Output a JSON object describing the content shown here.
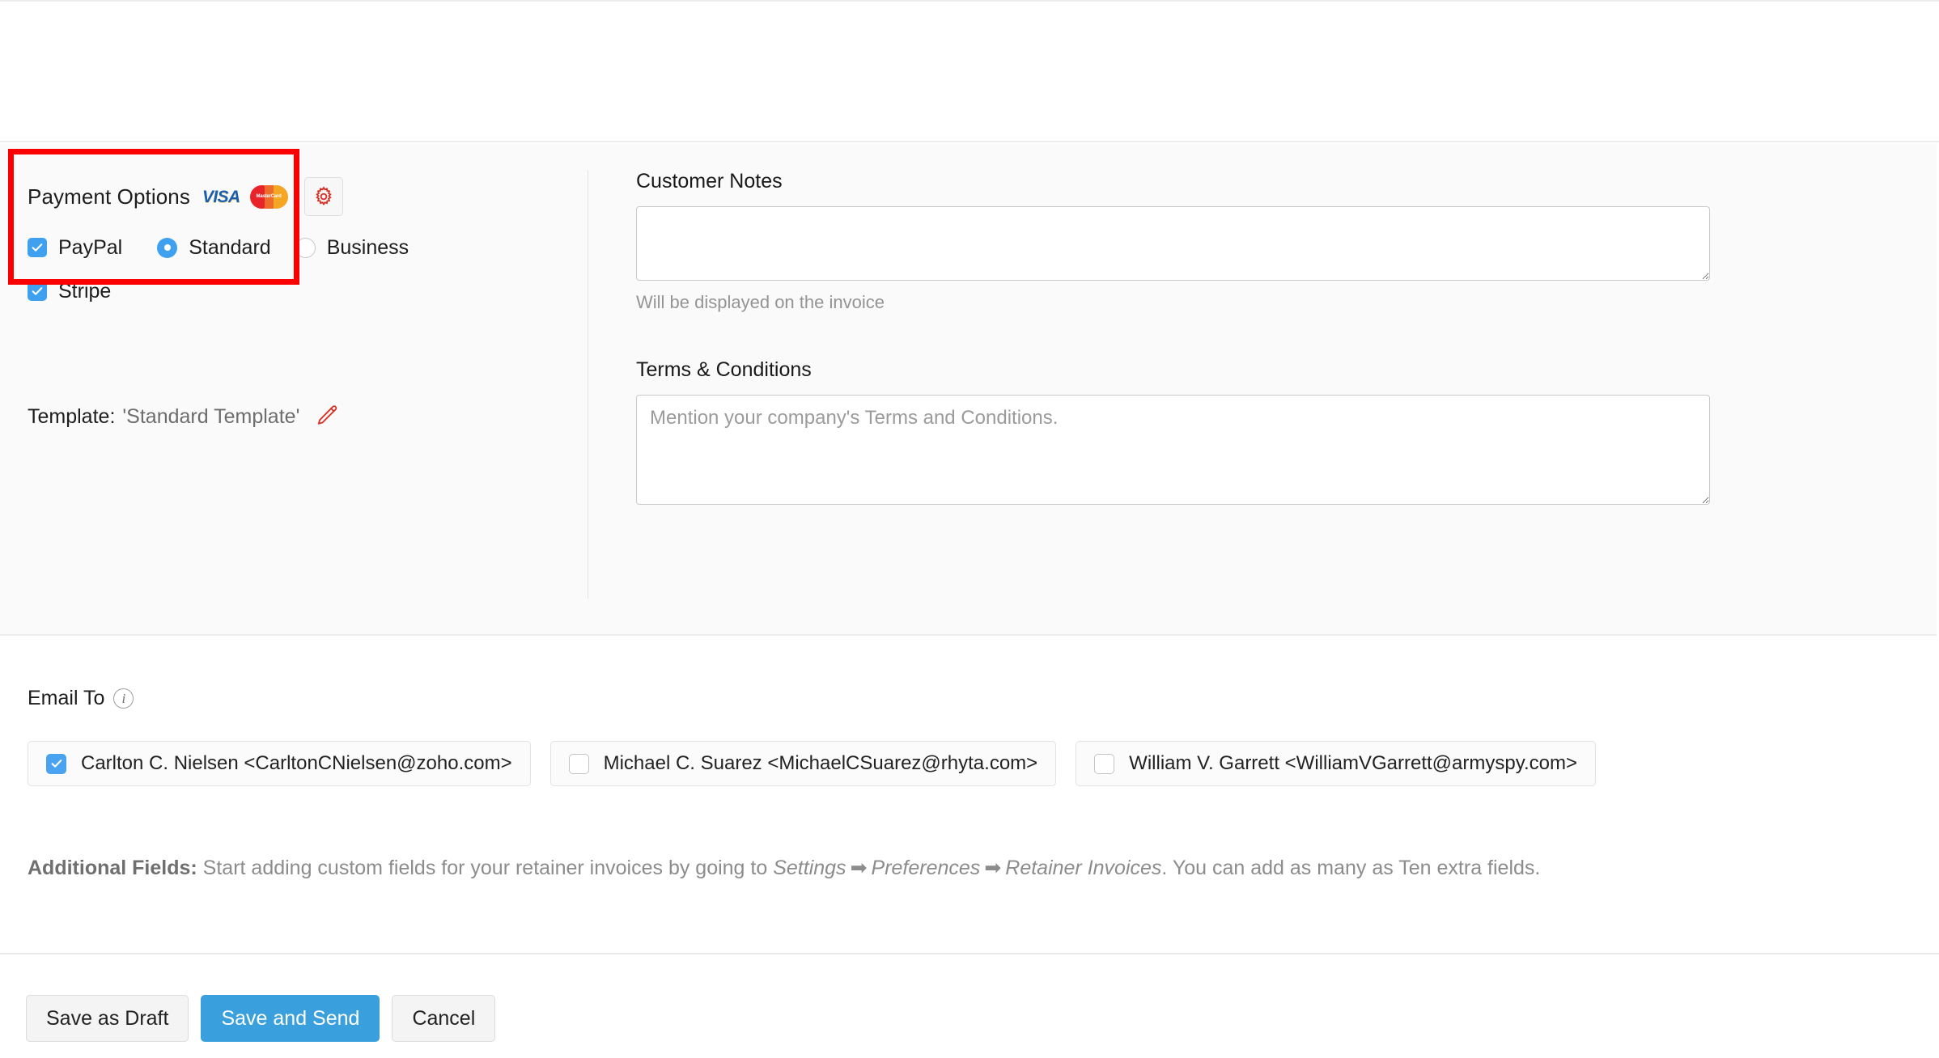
{
  "payment": {
    "title": "Payment Options",
    "visa_logo": "VISA",
    "mastercard_logo": "MasterCard",
    "gear_icon": "gear-icon",
    "options": [
      {
        "label": "PayPal",
        "checked": true
      },
      {
        "label": "Stripe",
        "checked": true
      }
    ],
    "paypal_modes": [
      {
        "label": "Standard",
        "selected": true
      },
      {
        "label": "Business",
        "selected": false
      }
    ]
  },
  "template": {
    "label": "Template:",
    "value": "'Standard Template'",
    "edit_icon": "pencil-icon"
  },
  "customer_notes": {
    "label": "Customer Notes",
    "value": "",
    "placeholder": "",
    "help": "Will be displayed on the invoice"
  },
  "terms": {
    "label": "Terms & Conditions",
    "value": "",
    "placeholder": "Mention your company's Terms and Conditions."
  },
  "email_to": {
    "label": "Email To",
    "info_icon": "info-icon",
    "recipients": [
      {
        "label": "Carlton C. Nielsen <CarltonCNielsen@zoho.com>",
        "checked": true
      },
      {
        "label": "Michael C. Suarez <MichaelCSuarez@rhyta.com>",
        "checked": false
      },
      {
        "label": "William V. Garrett <WilliamVGarrett@armyspy.com>",
        "checked": false
      }
    ]
  },
  "additional_fields": {
    "title": "Additional Fields:",
    "text_1": "Start adding custom fields for your retainer invoices by going to",
    "path_1": "Settings",
    "arrow": "➡",
    "path_2": "Preferences",
    "path_3": "Retainer Invoices",
    "text_2": ". You can add as many as",
    "limit": "Ten",
    "text_3": "extra fields."
  },
  "footer": {
    "save_draft_label": "Save as Draft",
    "save_send_label": "Save and Send",
    "cancel_label": "Cancel"
  },
  "colors": {
    "accent_blue": "#3aa0dd",
    "checkbox_blue": "#3ea0ef",
    "highlight_red": "#fc0000",
    "gear_red": "#d93025",
    "pencil_red": "#d93025",
    "panel_grey": "#fafafa"
  }
}
